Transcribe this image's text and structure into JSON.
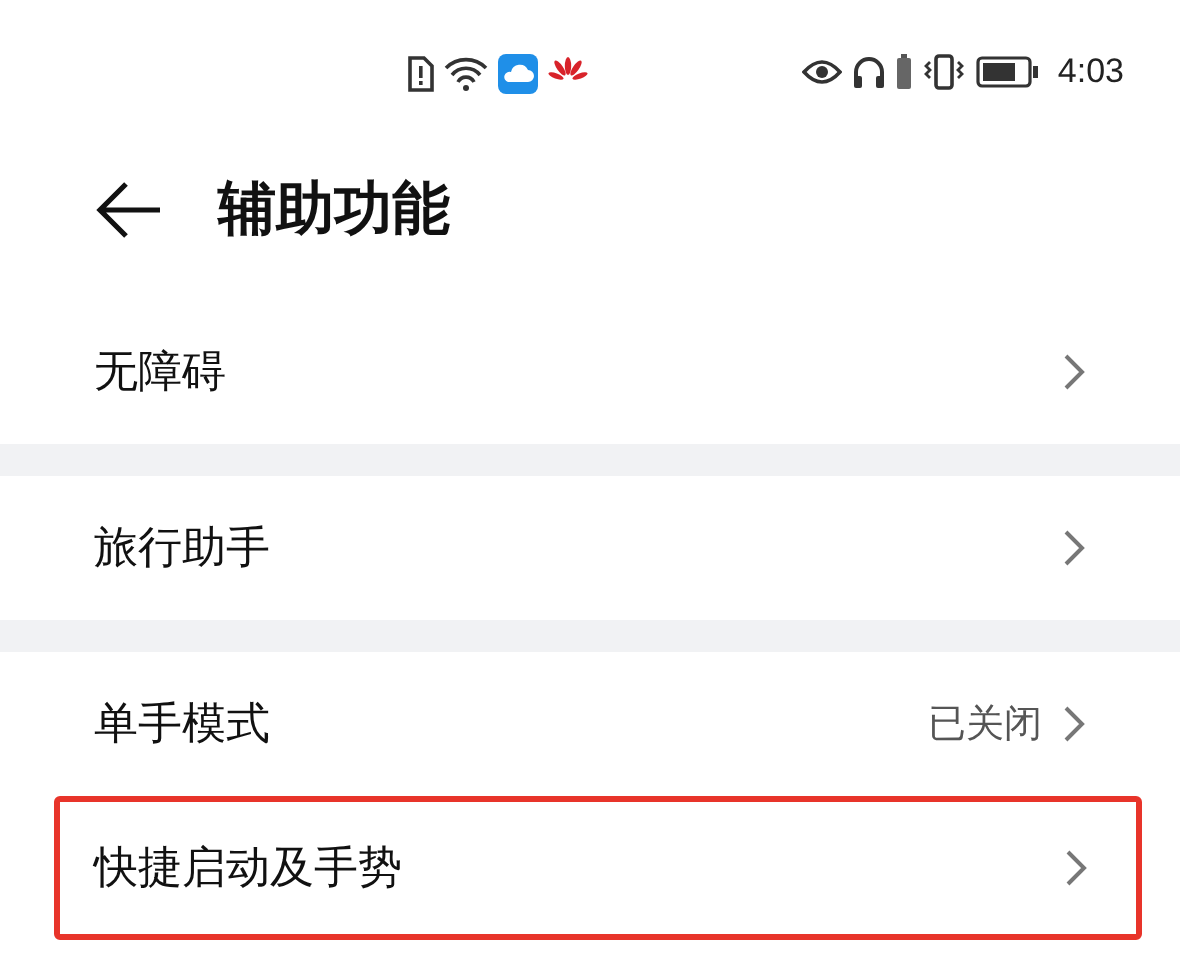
{
  "status_bar": {
    "time": "4:03"
  },
  "header": {
    "title": "辅助功能"
  },
  "groups": [
    {
      "items": [
        {
          "label": "无障碍",
          "highlighted": false
        }
      ]
    },
    {
      "items": [
        {
          "label": "旅行助手",
          "highlighted": false
        }
      ]
    },
    {
      "items": [
        {
          "label": "单手模式",
          "value": "已关闭",
          "highlighted": false
        },
        {
          "label": "快捷启动及手势",
          "highlighted": true
        }
      ]
    }
  ]
}
